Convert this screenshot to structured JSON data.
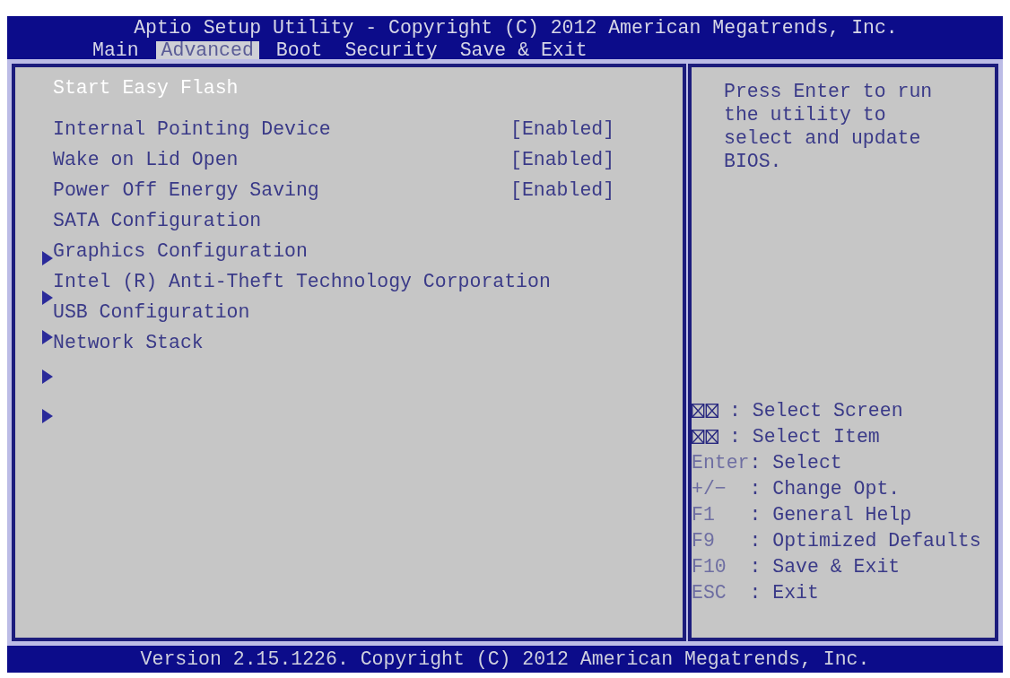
{
  "window": {
    "title": "Aptio Setup Utility - Copyright (C) 2012 American Megatrends, Inc."
  },
  "tabs": [
    {
      "label": "Main",
      "selected": false
    },
    {
      "label": "Advanced",
      "selected": true
    },
    {
      "label": "Boot",
      "selected": false
    },
    {
      "label": "Security",
      "selected": false
    },
    {
      "label": "Save & Exit",
      "selected": false
    }
  ],
  "settings": [
    {
      "kind": "action",
      "label": "Start Easy Flash",
      "selected": true
    },
    {
      "kind": "option",
      "label": "Internal Pointing Device",
      "value": "[Enabled]",
      "selected": false
    },
    {
      "kind": "option",
      "label": "Wake on Lid Open",
      "value": "[Enabled]",
      "selected": false
    },
    {
      "kind": "option",
      "label": "Power Off Energy Saving",
      "value": "[Enabled]",
      "selected": false
    },
    {
      "kind": "submenu",
      "label": "SATA Configuration",
      "selected": false
    },
    {
      "kind": "submenu",
      "label": "Graphics Configuration",
      "selected": false
    },
    {
      "kind": "submenu",
      "label": "Intel (R) Anti-Theft Technology Corporation",
      "selected": false
    },
    {
      "kind": "submenu",
      "label": "USB Configuration",
      "selected": false
    },
    {
      "kind": "submenu",
      "label": "Network Stack",
      "selected": false
    }
  ],
  "help_text": "Press Enter to run the utility to select and update BIOS.",
  "key_legend": [
    {
      "kind": "glyph",
      "action": ": Select Screen"
    },
    {
      "kind": "glyph",
      "action": ": Select Item"
    },
    {
      "kind": "text",
      "key": "Enter",
      "action": ": Select"
    },
    {
      "kind": "text",
      "key": "+/−",
      "action": ": Change Opt."
    },
    {
      "kind": "text",
      "key": "F1",
      "action": ": General Help"
    },
    {
      "kind": "text",
      "key": "F9",
      "action": ": Optimized Defaults"
    },
    {
      "kind": "text",
      "key": "F10",
      "action": ": Save & Exit"
    },
    {
      "kind": "text",
      "key": "ESC",
      "action": ": Exit"
    }
  ],
  "status_bar": "Version 2.15.1226. Copyright (C) 2012 American Megatrends, Inc."
}
